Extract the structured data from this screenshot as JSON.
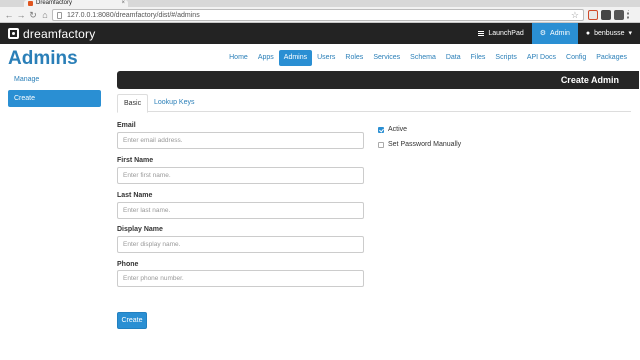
{
  "browser": {
    "tab_title": "Dreamfactory",
    "tab_close": "×",
    "url": "127.0.0.1:8080/dreamfactory/dist/#/admins",
    "back": "←",
    "forward": "→",
    "reload": "↻",
    "home": "⌂",
    "star": "☆"
  },
  "appnav": {
    "logo_text": "dreamfactory",
    "launchpad_label": "LaunchPad",
    "admin_label": "Admin",
    "user_label": "benbusse",
    "user_caret": "▾"
  },
  "page": {
    "title": "Admins"
  },
  "tabs": [
    {
      "label": "Home",
      "active": false
    },
    {
      "label": "Apps",
      "active": false
    },
    {
      "label": "Admins",
      "active": true
    },
    {
      "label": "Users",
      "active": false
    },
    {
      "label": "Roles",
      "active": false
    },
    {
      "label": "Services",
      "active": false
    },
    {
      "label": "Schema",
      "active": false
    },
    {
      "label": "Data",
      "active": false
    },
    {
      "label": "Files",
      "active": false
    },
    {
      "label": "Scripts",
      "active": false
    },
    {
      "label": "API Docs",
      "active": false
    },
    {
      "label": "Config",
      "active": false
    },
    {
      "label": "Packages",
      "active": false
    }
  ],
  "sidebar": {
    "items": [
      {
        "label": "Manage",
        "active": false
      },
      {
        "label": "Create",
        "active": true
      }
    ]
  },
  "panel": {
    "banner_title": "Create Admin",
    "subtabs": [
      {
        "label": "Basic",
        "active": true
      },
      {
        "label": "Lookup Keys",
        "active": false
      }
    ]
  },
  "form": {
    "email": {
      "label": "Email",
      "placeholder": "Enter email address.",
      "value": ""
    },
    "first_name": {
      "label": "First Name",
      "placeholder": "Enter first name.",
      "value": ""
    },
    "last_name": {
      "label": "Last Name",
      "placeholder": "Enter last name.",
      "value": ""
    },
    "display_name": {
      "label": "Display Name",
      "placeholder": "Enter display name.",
      "value": ""
    },
    "phone": {
      "label": "Phone",
      "placeholder": "Enter phone number.",
      "value": ""
    },
    "active": {
      "label": "Active",
      "checked": true
    },
    "set_password": {
      "label": "Set Password Manually",
      "checked": false
    },
    "submit_label": "Create"
  },
  "colors": {
    "accent": "#2a8fd3",
    "nav_bg": "#232323",
    "title": "#2a7fb8"
  }
}
